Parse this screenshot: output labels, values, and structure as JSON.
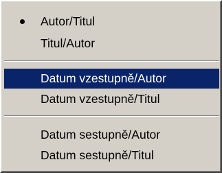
{
  "menu": {
    "items": [
      {
        "label": "Autor/Titul",
        "checked": true,
        "selected": false
      },
      {
        "label": "Titul/Autor",
        "checked": false,
        "selected": false
      },
      {
        "label": "Datum vzestupně/Autor",
        "checked": false,
        "selected": true
      },
      {
        "label": "Datum vzestupně/Titul",
        "checked": false,
        "selected": false
      },
      {
        "label": "Datum sestupně/Autor",
        "checked": false,
        "selected": false
      },
      {
        "label": "Datum sestupně/Titul",
        "checked": false,
        "selected": false
      }
    ]
  },
  "colors": {
    "menu_background": "#d4d0c8",
    "highlight": "#0a246a",
    "highlight_text": "#ffffff",
    "text": "#000000"
  }
}
